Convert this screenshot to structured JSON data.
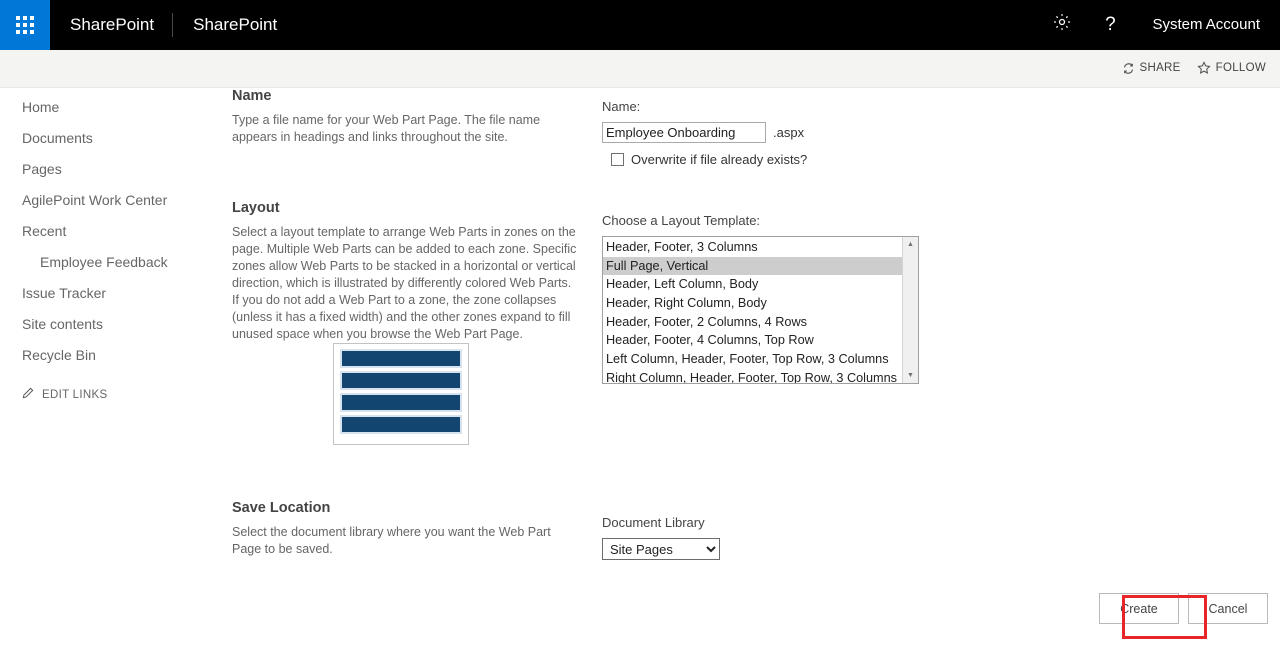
{
  "suitebar": {
    "app_launcher_icon": "waffle-grid-icon",
    "brand": "SharePoint",
    "site": "SharePoint",
    "settings_icon": "gear-icon",
    "help_icon": "help-icon",
    "user": "System Account"
  },
  "topband": {
    "share_icon": "share-icon",
    "share_label": "SHARE",
    "follow_icon": "star-icon",
    "follow_label": "FOLLOW"
  },
  "sidebar": {
    "items": [
      {
        "label": "Home",
        "child": false
      },
      {
        "label": "Documents",
        "child": false
      },
      {
        "label": "Pages",
        "child": false
      },
      {
        "label": "AgilePoint Work Center",
        "child": false
      },
      {
        "label": "Recent",
        "child": false
      },
      {
        "label": "Employee Feedback",
        "child": true
      },
      {
        "label": "Issue Tracker",
        "child": false
      },
      {
        "label": "Site contents",
        "child": false
      },
      {
        "label": "Recycle Bin",
        "child": false
      }
    ],
    "edit_links_icon": "pencil-icon",
    "edit_links_label": "EDIT LINKS"
  },
  "name_section": {
    "title": "Name",
    "description": "Type a file name for your Web Part Page.  The file name appears in headings and links throughout the site.",
    "field_label": "Name:",
    "value": "Employee Onboarding",
    "placeholder": "",
    "extension": ".aspx",
    "overwrite_label": "Overwrite if file already exists?",
    "overwrite_checked": false
  },
  "layout_section": {
    "title": "Layout",
    "description": "Select a layout template to arrange Web Parts in zones on the page. Multiple Web Parts can be added to each zone. Specific zones allow Web Parts to be stacked in a horizontal or vertical direction, which is illustrated by differently colored Web Parts. If you do not add a Web Part to a zone, the zone collapses (unless it has a fixed width) and the other zones expand to fill unused space when you browse the Web Part Page.",
    "field_label": "Choose a Layout Template:",
    "options": [
      "Header, Footer, 3 Columns",
      "Full Page, Vertical",
      "Header, Left Column, Body",
      "Header, Right Column, Body",
      "Header, Footer, 2 Columns, 4 Rows",
      "Header, Footer, 4 Columns, Top Row",
      "Left Column, Header, Footer, Top Row, 3 Columns",
      "Right Column, Header, Footer, Top Row, 3 Columns"
    ],
    "selected": "Full Page, Vertical",
    "scroll_up_icon": "caret-up-icon",
    "scroll_down_icon": "caret-down-icon",
    "preview_zone_count": 4,
    "preview_zone_color": "#12456f",
    "preview_border_color": "#d6e3ef"
  },
  "save_section": {
    "title": "Save Location",
    "description": "Select the document library where you want the Web Part Page to be saved.",
    "field_label": "Document Library",
    "selected": "Site Pages",
    "options": [
      "Site Pages"
    ]
  },
  "footer": {
    "create_label": "Create",
    "cancel_label": "Cancel",
    "highlight_color": "#e8262a"
  }
}
